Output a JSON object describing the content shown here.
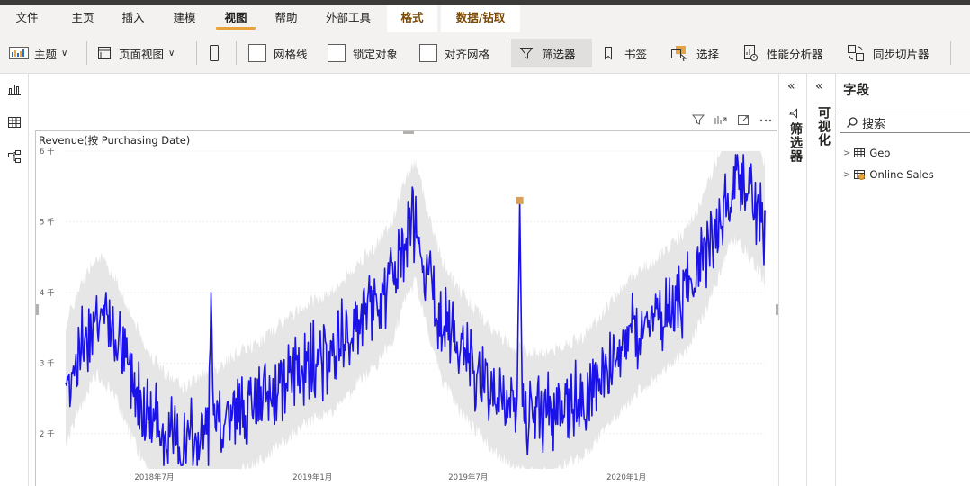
{
  "tabs": [
    {
      "label": "文件",
      "active": false,
      "contextual": false
    },
    {
      "label": "主页",
      "active": false,
      "contextual": false
    },
    {
      "label": "插入",
      "active": false,
      "contextual": false
    },
    {
      "label": "建模",
      "active": false,
      "contextual": false
    },
    {
      "label": "视图",
      "active": true,
      "contextual": false
    },
    {
      "label": "帮助",
      "active": false,
      "contextual": false
    },
    {
      "label": "外部工具",
      "active": false,
      "contextual": false
    },
    {
      "label": "格式",
      "active": false,
      "contextual": true
    },
    {
      "label": "数据/钻取",
      "active": false,
      "contextual": true
    }
  ],
  "ribbon": {
    "theme_label": "主题",
    "page_view_label": "页面视图",
    "gridlines_label": "网格线",
    "lock_objects_label": "锁定对象",
    "snap_grid_label": "对齐网格",
    "filters_label": "筛选器",
    "bookmarks_label": "书签",
    "selection_label": "选择",
    "performance_label": "性能分析器",
    "sync_slicers_label": "同步切片器"
  },
  "panes": {
    "filters_label": "筛选器",
    "visualizations_label": "可视化",
    "fields_title": "字段",
    "search_placeholder": "搜索",
    "tables": [
      {
        "name": "Geo"
      },
      {
        "name": "Online Sales"
      }
    ]
  },
  "colors": {
    "accent": "#e8a33d",
    "line": "#1a12e6",
    "band": "#e6e6e6",
    "anomaly": "#d9a05b"
  },
  "chart_data": {
    "type": "line",
    "title": "Revenue(按 Purchasing Date)",
    "xlabel": "",
    "ylabel": "",
    "x_ticks": [
      "2018年7月",
      "2019年1月",
      "2019年7月",
      "2020年1月"
    ],
    "y_ticks": [
      "2 千",
      "3 千",
      "4 千",
      "5 千",
      "6 千"
    ],
    "ylim": [
      1.5,
      6
    ],
    "x_range": [
      "2018-03-20",
      "2020-06-10"
    ],
    "grid": true,
    "legend": "none",
    "anchors": [
      [
        "2018-03-20",
        2.7
      ],
      [
        "2018-04-05",
        3.2
      ],
      [
        "2018-04-25",
        3.7
      ],
      [
        "2018-05-15",
        3.4
      ],
      [
        "2018-06-05",
        2.8
      ],
      [
        "2018-06-25",
        2.3
      ],
      [
        "2018-07-15",
        2.0
      ],
      [
        "2018-08-05",
        1.8
      ],
      [
        "2018-08-25",
        2.0
      ],
      [
        "2018-09-15",
        2.1
      ],
      [
        "2018-10-05",
        2.3
      ],
      [
        "2018-10-25",
        2.4
      ],
      [
        "2018-11-15",
        2.6
      ],
      [
        "2018-12-05",
        2.8
      ],
      [
        "2018-12-25",
        3.0
      ],
      [
        "2019-01-15",
        3.1
      ],
      [
        "2019-02-05",
        3.3
      ],
      [
        "2019-02-25",
        3.6
      ],
      [
        "2019-03-15",
        3.8
      ],
      [
        "2019-04-05",
        4.2
      ],
      [
        "2019-04-20",
        4.8
      ],
      [
        "2019-05-01",
        5.0
      ],
      [
        "2019-05-15",
        4.3
      ],
      [
        "2019-06-01",
        3.6
      ],
      [
        "2019-06-20",
        3.2
      ],
      [
        "2019-07-10",
        2.9
      ],
      [
        "2019-07-30",
        2.6
      ],
      [
        "2019-08-20",
        2.4
      ],
      [
        "2019-09-10",
        2.3
      ],
      [
        "2019-09-30",
        2.3
      ],
      [
        "2019-10-20",
        2.4
      ],
      [
        "2019-11-10",
        2.5
      ],
      [
        "2019-12-01",
        2.8
      ],
      [
        "2019-12-20",
        3.1
      ],
      [
        "2020-01-10",
        3.4
      ],
      [
        "2020-02-01",
        3.6
      ],
      [
        "2020-02-20",
        3.8
      ],
      [
        "2020-03-10",
        4.0
      ],
      [
        "2020-03-30",
        4.5
      ],
      [
        "2020-04-15",
        5.0
      ],
      [
        "2020-05-01",
        5.6
      ],
      [
        "2020-05-15",
        5.5
      ],
      [
        "2020-06-01",
        5.2
      ],
      [
        "2020-06-10",
        5.0
      ]
    ],
    "spikes": [
      [
        "2018-05-06",
        4.0
      ],
      [
        "2018-09-05",
        4.0
      ],
      [
        "2019-08-30",
        5.3
      ]
    ],
    "anomaly_marker": [
      "2019-08-30",
      5.3
    ]
  }
}
